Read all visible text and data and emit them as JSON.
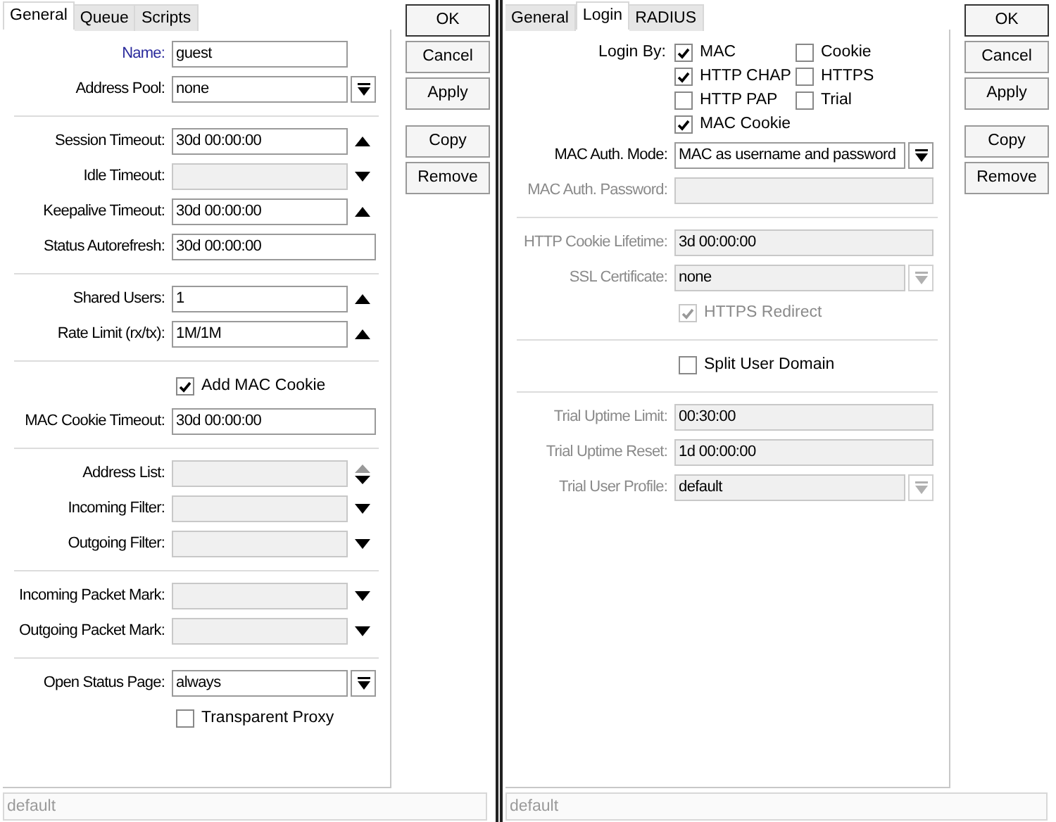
{
  "panels": [
    {
      "tabs": [
        {
          "label": "General",
          "selected": true
        },
        {
          "label": "Queue",
          "selected": false
        },
        {
          "label": "Scripts",
          "selected": false
        }
      ],
      "rows": [
        {
          "kind": "narrowfield",
          "label": "Name:",
          "value": "guest",
          "required": true,
          "disabled": false
        },
        {
          "kind": "dropfield",
          "label": "Address Pool:",
          "value": "none",
          "disabled": false
        },
        {
          "kind": "separator"
        },
        {
          "kind": "upfield",
          "label": "Session Timeout:",
          "value": "30d 00:00:00",
          "disabled": false
        },
        {
          "kind": "downfield",
          "label": "Idle Timeout:",
          "disabled": false
        },
        {
          "kind": "upfield",
          "label": "Keepalive Timeout:",
          "value": "30d 00:00:00",
          "disabled": false
        },
        {
          "kind": "field",
          "label": "Status Autorefresh:",
          "value": "30d 00:00:00",
          "disabled": false
        },
        {
          "kind": "separator"
        },
        {
          "kind": "upfield",
          "label": "Shared Users:",
          "value": "1",
          "disabled": false
        },
        {
          "kind": "upfield",
          "label": "Rate Limit (rx/tx):",
          "value": "1M/1M",
          "disabled": false
        },
        {
          "kind": "separator"
        },
        {
          "kind": "checkbox",
          "label": "Add MAC Cookie",
          "checked": true,
          "disabled": false
        },
        {
          "kind": "field",
          "label": "MAC Cookie Timeout:",
          "value": "30d 00:00:00",
          "disabled": false
        },
        {
          "kind": "separator"
        },
        {
          "kind": "updownfield",
          "label": "Address List:",
          "disabled": false
        },
        {
          "kind": "downfield",
          "label": "Incoming Filter:",
          "disabled": false
        },
        {
          "kind": "downfield",
          "label": "Outgoing Filter:",
          "disabled": false
        },
        {
          "kind": "separator"
        },
        {
          "kind": "downfield",
          "label": "Incoming Packet Mark:",
          "disabled": false
        },
        {
          "kind": "downfield",
          "label": "Outgoing Packet Mark:",
          "disabled": false
        },
        {
          "kind": "separator"
        },
        {
          "kind": "dropfield",
          "label": "Open Status Page:",
          "value": "always",
          "disabled": false
        },
        {
          "kind": "checkbox",
          "label": "Transparent Proxy",
          "checked": false,
          "disabled": false
        }
      ],
      "buttons": [
        "OK",
        "Cancel",
        "Apply",
        "Copy",
        "Remove"
      ],
      "status_bar": "default"
    },
    {
      "tabs": [
        {
          "label": "General",
          "selected": false
        },
        {
          "label": "Login",
          "selected": true
        },
        {
          "label": "RADIUS",
          "selected": false
        }
      ],
      "rows": [
        {
          "kind": "checkgroup",
          "label": "Login By:",
          "options": [
            {
              "label": "MAC",
              "checked": true
            },
            {
              "label": "Cookie",
              "checked": false
            },
            {
              "label": "HTTP CHAP",
              "checked": true
            },
            {
              "label": "HTTPS",
              "checked": false
            },
            {
              "label": "HTTP PAP",
              "checked": false
            },
            {
              "label": "Trial",
              "checked": false
            },
            {
              "label": "MAC Cookie",
              "checked": true
            }
          ]
        },
        {
          "kind": "dropfield",
          "label": "MAC Auth. Mode:",
          "value": "MAC as username and password",
          "disabled": false
        },
        {
          "kind": "field",
          "label": "MAC Auth. Password:",
          "disabled": true
        },
        {
          "kind": "separator"
        },
        {
          "kind": "field",
          "label": "HTTP Cookie Lifetime:",
          "value": "3d 00:00:00",
          "disabled": true
        },
        {
          "kind": "dropfield",
          "label": "SSL Certificate:",
          "value": "none",
          "disabled": true
        },
        {
          "kind": "checkbox",
          "label": "HTTPS Redirect",
          "checked": true,
          "disabled": true
        },
        {
          "kind": "separator"
        },
        {
          "kind": "checkbox",
          "label": "Split User Domain",
          "checked": false,
          "disabled": false
        },
        {
          "kind": "separator"
        },
        {
          "kind": "field",
          "label": "Trial Uptime Limit:",
          "value": "00:30:00",
          "disabled": true
        },
        {
          "kind": "field",
          "label": "Trial Uptime Reset:",
          "value": "1d 00:00:00",
          "disabled": true
        },
        {
          "kind": "dropfield",
          "label": "Trial User Profile:",
          "value": "default",
          "disabled": true
        }
      ],
      "buttons": [
        "OK",
        "Cancel",
        "Apply",
        "Copy",
        "Remove"
      ],
      "status_bar": "default"
    }
  ]
}
